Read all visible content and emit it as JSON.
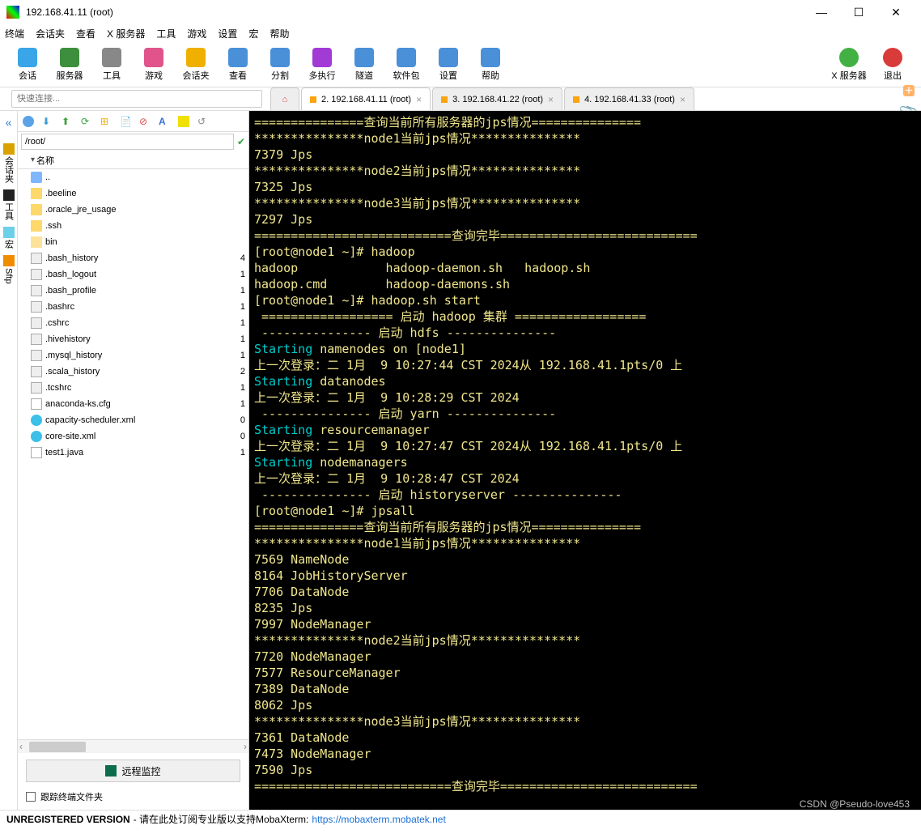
{
  "window": {
    "title": "192.168.41.11 (root)"
  },
  "menu": [
    "终端",
    "会话夹",
    "查看",
    "X 服务器",
    "工具",
    "游戏",
    "设置",
    "宏",
    "帮助"
  ],
  "toolbar": {
    "items": [
      {
        "label": "会话",
        "color": "#3aa5e8"
      },
      {
        "label": "服务器",
        "color": "#3d8f3d"
      },
      {
        "label": "工具",
        "color": "#888"
      },
      {
        "label": "游戏",
        "color": "#e0548b"
      },
      {
        "label": "会话夹",
        "color": "#f0b000"
      },
      {
        "label": "查看",
        "color": "#4a90d9"
      },
      {
        "label": "分割",
        "color": "#4a90d9"
      },
      {
        "label": "多执行",
        "color": "#a23bd6"
      },
      {
        "label": "隧道",
        "color": "#4a90d9"
      },
      {
        "label": "软件包",
        "color": "#4a90d9"
      },
      {
        "label": "设置",
        "color": "#4a90d9"
      },
      {
        "label": "帮助",
        "color": "#4a90d9"
      }
    ],
    "right": [
      {
        "label": "X 服务器",
        "color": "#43b043"
      },
      {
        "label": "退出",
        "color": "#d93a3a"
      }
    ]
  },
  "quick_placeholder": "快速连接...",
  "tabs": [
    {
      "label": "",
      "home": true
    },
    {
      "label": "2. 192.168.41.11 (root)",
      "active": true
    },
    {
      "label": "3. 192.168.41.22 (root)"
    },
    {
      "label": "4. 192.168.41.33 (root)"
    }
  ],
  "side_vert": [
    {
      "txt": "会话夹",
      "color": "#d9a200"
    },
    {
      "txt": "工具",
      "color": "#222"
    },
    {
      "txt": "宏",
      "color": "#6bd0e8"
    },
    {
      "txt": "Sftp",
      "color": "#f08c00"
    }
  ],
  "sftp": {
    "path": "/root/",
    "header_name": "名称",
    "files": [
      {
        "name": "..",
        "type": "up",
        "r": ""
      },
      {
        "name": ".beeline",
        "type": "folder",
        "r": ""
      },
      {
        "name": ".oracle_jre_usage",
        "type": "folder",
        "r": ""
      },
      {
        "name": ".ssh",
        "type": "folder",
        "r": ""
      },
      {
        "name": "bin",
        "type": "folderb",
        "r": ""
      },
      {
        "name": ".bash_history",
        "type": "file",
        "r": "4"
      },
      {
        "name": ".bash_logout",
        "type": "file",
        "r": "1"
      },
      {
        "name": ".bash_profile",
        "type": "file",
        "r": "1"
      },
      {
        "name": ".bashrc",
        "type": "file",
        "r": "1"
      },
      {
        "name": ".cshrc",
        "type": "file",
        "r": "1"
      },
      {
        "name": ".hivehistory",
        "type": "file",
        "r": "1"
      },
      {
        "name": ".mysql_history",
        "type": "file",
        "r": "1"
      },
      {
        "name": ".scala_history",
        "type": "file",
        "r": "2"
      },
      {
        "name": ".tcshrc",
        "type": "file",
        "r": "1"
      },
      {
        "name": "anaconda-ks.cfg",
        "type": "file-s",
        "r": "1"
      },
      {
        "name": "capacity-scheduler.xml",
        "type": "edge",
        "r": "0"
      },
      {
        "name": "core-site.xml",
        "type": "edge",
        "r": "0"
      },
      {
        "name": "test1.java",
        "type": "file-s",
        "r": "1"
      }
    ],
    "remote_btn": "远程监控",
    "follow_label": "跟踪终端文件夹"
  },
  "terminal_lines": [
    {
      "t": "===============查询当前所有服务器的jps情况===============",
      "c": "y"
    },
    {
      "t": "***************node1当前jps情况***************",
      "c": "y"
    },
    {
      "t": "7379 Jps",
      "c": "y"
    },
    {
      "t": "***************node2当前jps情况***************",
      "c": "y"
    },
    {
      "t": "7325 Jps",
      "c": "y"
    },
    {
      "t": "***************node3当前jps情况***************",
      "c": "y"
    },
    {
      "t": "7297 Jps",
      "c": "y"
    },
    {
      "t": "===========================查询完毕===========================",
      "c": "y"
    },
    {
      "seg": [
        {
          "t": "[root@node1 ~]# hadoop",
          "c": "y"
        }
      ]
    },
    {
      "t": "hadoop            hadoop-daemon.sh   hadoop.sh",
      "c": "y"
    },
    {
      "t": "hadoop.cmd        hadoop-daemons.sh",
      "c": "y"
    },
    {
      "seg": [
        {
          "t": "[root@node1 ~]# hadoop.sh start",
          "c": "y"
        }
      ]
    },
    {
      "t": " ================== 启动 hadoop 集群 ==================",
      "c": "y"
    },
    {
      "t": " --------------- 启动 hdfs ---------------",
      "c": "y"
    },
    {
      "seg": [
        {
          "t": "Starting",
          "c": "c"
        },
        {
          "t": " namenodes on [node1]",
          "c": "y"
        }
      ]
    },
    {
      "t": "上一次登录：二 1月  9 10:27:44 CST 2024从 192.168.41.1pts/0 上",
      "c": "y"
    },
    {
      "seg": [
        {
          "t": "Starting",
          "c": "c"
        },
        {
          "t": " datanodes",
          "c": "y"
        }
      ]
    },
    {
      "t": "上一次登录：二 1月  9 10:28:29 CST 2024",
      "c": "y"
    },
    {
      "t": " --------------- 启动 yarn ---------------",
      "c": "y"
    },
    {
      "seg": [
        {
          "t": "Starting",
          "c": "c"
        },
        {
          "t": " resourcemanager",
          "c": "y"
        }
      ]
    },
    {
      "t": "上一次登录：二 1月  9 10:27:47 CST 2024从 192.168.41.1pts/0 上",
      "c": "y"
    },
    {
      "seg": [
        {
          "t": "Starting",
          "c": "c"
        },
        {
          "t": " nodemanagers",
          "c": "y"
        }
      ]
    },
    {
      "t": "上一次登录：二 1月  9 10:28:47 CST 2024",
      "c": "y"
    },
    {
      "t": " --------------- 启动 historyserver ---------------",
      "c": "y"
    },
    {
      "seg": [
        {
          "t": "[root@node1 ~]# jpsall",
          "c": "y"
        }
      ]
    },
    {
      "t": "===============查询当前所有服务器的jps情况===============",
      "c": "y"
    },
    {
      "t": "***************node1当前jps情况***************",
      "c": "y"
    },
    {
      "t": "7569 NameNode",
      "c": "y"
    },
    {
      "t": "8164 JobHistoryServer",
      "c": "y"
    },
    {
      "t": "7706 DataNode",
      "c": "y"
    },
    {
      "t": "8235 Jps",
      "c": "y"
    },
    {
      "t": "7997 NodeManager",
      "c": "y"
    },
    {
      "t": "***************node2当前jps情况***************",
      "c": "y"
    },
    {
      "t": "7720 NodeManager",
      "c": "y"
    },
    {
      "t": "7577 ResourceManager",
      "c": "y"
    },
    {
      "t": "7389 DataNode",
      "c": "y"
    },
    {
      "t": "8062 Jps",
      "c": "y"
    },
    {
      "t": "***************node3当前jps情况***************",
      "c": "y"
    },
    {
      "t": "7361 DataNode",
      "c": "y"
    },
    {
      "t": "7473 NodeManager",
      "c": "y"
    },
    {
      "t": "7590 Jps",
      "c": "y"
    },
    {
      "t": "===========================查询完毕===========================",
      "c": "y"
    }
  ],
  "status": {
    "unreg": "UNREGISTERED VERSION",
    "mid": "- 请在此处订阅专业版以支持MobaXterm:",
    "link": "https://mobaxterm.mobatek.net"
  },
  "watermark": "CSDN @Pseudo-love453"
}
